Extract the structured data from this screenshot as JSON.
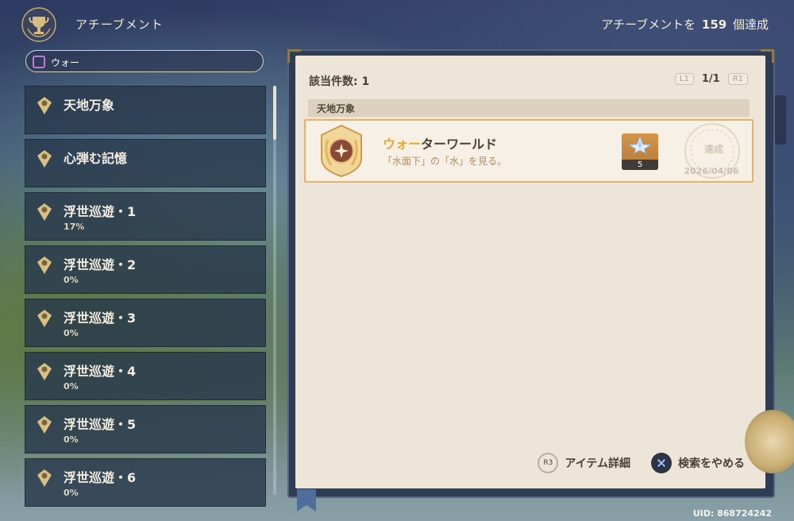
{
  "header": {
    "title": "アチーブメント",
    "count_prefix": "アチーブメントを",
    "count_value": "159",
    "count_suffix": "個達成"
  },
  "search": {
    "value": "ウォー"
  },
  "sidebar": {
    "items": [
      {
        "name": "天地万象",
        "percent": ""
      },
      {
        "name": "心弾む記憶",
        "percent": ""
      },
      {
        "name": "浮世巡遊・1",
        "percent": "17%"
      },
      {
        "name": "浮世巡遊・2",
        "percent": "0%"
      },
      {
        "name": "浮世巡遊・3",
        "percent": "0%"
      },
      {
        "name": "浮世巡遊・4",
        "percent": "0%"
      },
      {
        "name": "浮世巡遊・5",
        "percent": "0%"
      },
      {
        "name": "浮世巡遊・6",
        "percent": "0%"
      }
    ]
  },
  "results": {
    "count_label": "該当件数: 1",
    "prev_button": "L1",
    "page": "1/1",
    "next_button": "R1",
    "category": "天地万象",
    "achievement": {
      "title_highlight": "ウォー",
      "title_rest": "ターワールド",
      "description": "「水面下」の「水」を見る。",
      "reward_qty": "5",
      "status": "達成",
      "date": "2026/04/06"
    }
  },
  "footer": {
    "detail_key": "R3",
    "detail_label": "アイテム詳細",
    "cancel_label": "検索をやめる"
  },
  "uid": "UID: 868724242",
  "colors": {
    "highlight": "#f0a526",
    "accent_border": "#e6b26a",
    "panel_bg": "#ece5d8"
  }
}
